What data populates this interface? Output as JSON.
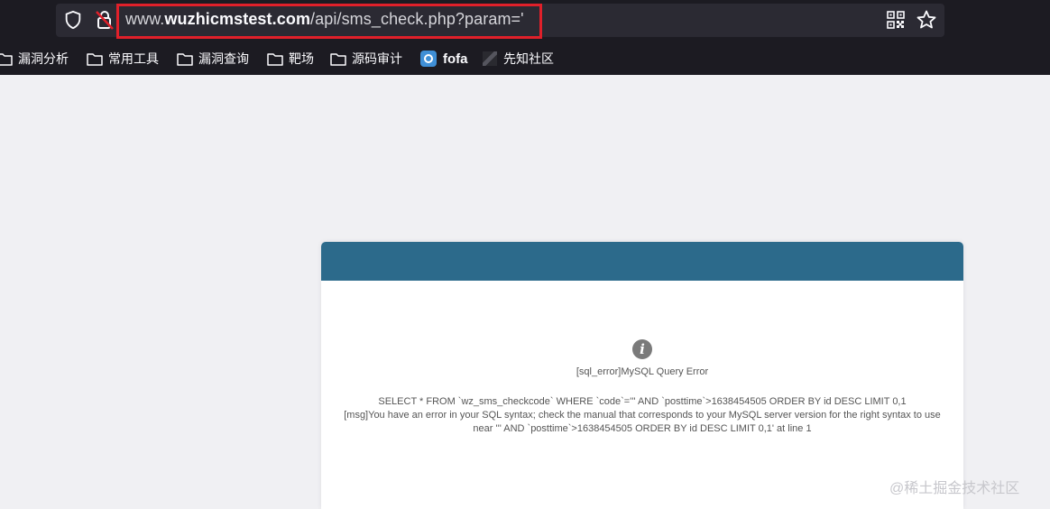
{
  "browser": {
    "url_prefix": "www.",
    "url_host": "wuzhicmstest.com",
    "url_path": "/api/sms_check.php?param='",
    "bookmarks": [
      {
        "label": "漏洞分析",
        "icon": "folder-icon"
      },
      {
        "label": "常用工具",
        "icon": "folder-icon"
      },
      {
        "label": "漏洞查询",
        "icon": "folder-icon"
      },
      {
        "label": "靶场",
        "icon": "folder-icon"
      },
      {
        "label": "源码审计",
        "icon": "folder-icon"
      },
      {
        "label": "fofa",
        "icon": "fofa-icon"
      },
      {
        "label": "先知社区",
        "icon": "xianzhi-icon"
      }
    ]
  },
  "error_card": {
    "icon": "info-icon",
    "title": "[sql_error]MySQL Query Error",
    "query_line": "SELECT * FROM `wz_sms_checkcode` WHERE `code`=''' AND `posttime`>1638454505 ORDER BY id DESC LIMIT 0,1",
    "msg_line": "[msg]You have an error in your SQL syntax; check the manual that corresponds to your MySQL server version for the right syntax to use near ''' AND `posttime`>1638454505 ORDER BY id DESC LIMIT 0,1' at line 1",
    "header_color": "#2c6a8b"
  },
  "watermark": "@稀土掘金技术社区",
  "colors": {
    "url_highlight": "#e0202a",
    "chrome_bg": "#1c1b22"
  }
}
